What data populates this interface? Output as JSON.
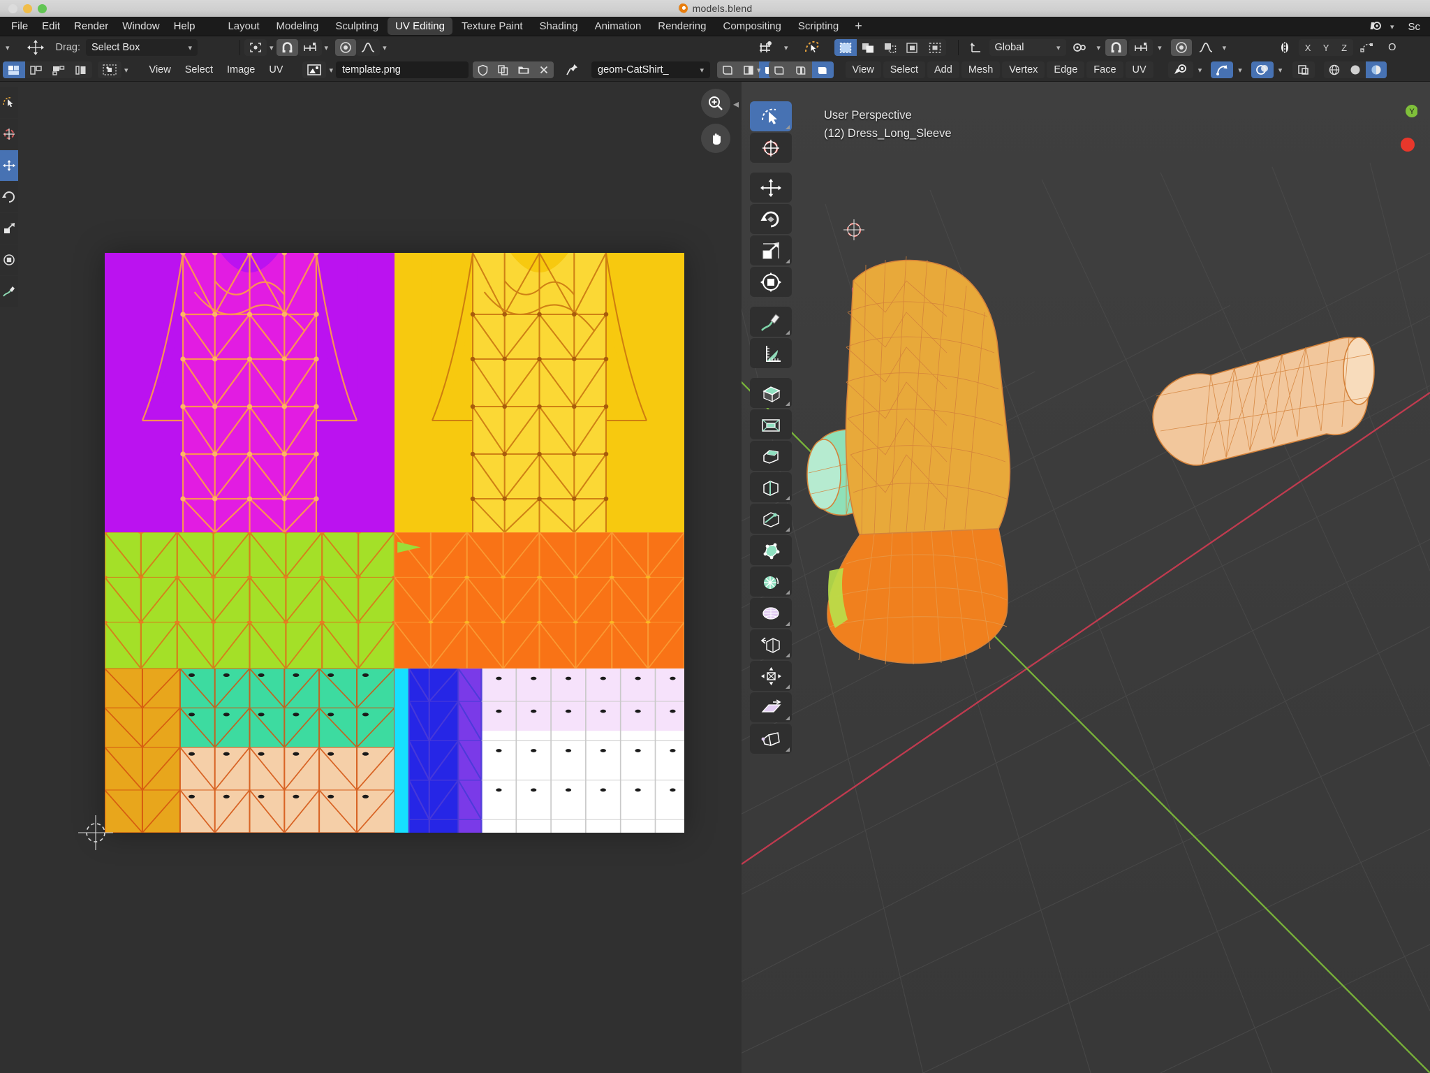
{
  "window": {
    "title": "models.blend",
    "logo_icon": "blender-logo"
  },
  "topbar": {
    "menus": [
      "File",
      "Edit",
      "Render",
      "Window",
      "Help"
    ],
    "workspaces": [
      {
        "label": "Layout",
        "active": false
      },
      {
        "label": "Modeling",
        "active": false
      },
      {
        "label": "Sculpting",
        "active": false
      },
      {
        "label": "UV Editing",
        "active": true
      },
      {
        "label": "Texture Paint",
        "active": false
      },
      {
        "label": "Shading",
        "active": false
      },
      {
        "label": "Animation",
        "active": false
      },
      {
        "label": "Rendering",
        "active": false
      },
      {
        "label": "Compositing",
        "active": false
      },
      {
        "label": "Scripting",
        "active": false
      }
    ],
    "add_workspace_label": "+",
    "scene_icon": "scene-icon",
    "scene_chevron": "chevron-down-icon",
    "scene_label": "Sc"
  },
  "uv_editor": {
    "tool_settings": {
      "editor_type_chevron": "chevron-down-icon",
      "transform_icon": "move-transform-icon",
      "drag_label": "Drag:",
      "drag_value": "Select Box",
      "drag_chevron": "chevron-down-icon",
      "pivot_icon": "pivot-point-icon",
      "pivot_chevron": "chevron-down-icon",
      "snap_magnet_icon": "snap-magnet-icon",
      "snap_type_icon": "snap-increment-icon",
      "snap_chevron": "chevron-down-icon",
      "proportional_icon": "proportional-edit-icon",
      "falloff_icon": "falloff-curve-icon",
      "falloff_chevron": "chevron-down-icon"
    },
    "header": {
      "uv_select_modes": [
        "uv-vertex-select-icon",
        "uv-edge-select-icon",
        "uv-face-select-icon",
        "uv-island-select-icon"
      ],
      "active_select_mode": 0,
      "sticky_icon": "sticky-selection-icon",
      "sticky_chevron": "chevron-down-icon",
      "menus": [
        "View",
        "Select",
        "Image",
        "UV"
      ],
      "image_icon": "image-datablock-icon",
      "image_chevron": "chevron-down-icon",
      "image_name": "template.png",
      "fake_user_icon": "shield-fake-user-icon",
      "new_copy_icon": "duplicate-icon",
      "open_icon": "folder-open-icon",
      "unlink_icon": "close-x-icon",
      "pin_icon": "pin-icon",
      "uvmap_name": "geom-CatShirt_",
      "uvmap_chevron": "chevron-down-icon",
      "display_modes": [
        "display-channels-icon",
        "display-overlay-a-icon",
        "display-overlay-b-icon"
      ],
      "active_display_mode": 2
    },
    "toolbar_icons": [
      "tweak-select-tool-icon",
      "cursor-tool-icon",
      "move-tool-icon",
      "rotate-tool-icon",
      "scale-tool-icon",
      "transform-tool-icon",
      "annotate-tool-icon"
    ],
    "active_toolbar_index": 2,
    "gizmos": [
      "zoom-gizmo-icon",
      "pan-hand-gizmo-icon"
    ],
    "collapse_icon": "chevron-left-icon",
    "uv_map_quadrants": [
      {
        "name": "shirt-front-magenta",
        "fill": "#e21ce2",
        "accent": "#bb12f0",
        "wire": "#ff8d3a"
      },
      {
        "name": "shirt-front-yellow",
        "fill": "#fbd42a",
        "accent": "#f5c400",
        "wire": "#c36a12"
      },
      {
        "name": "skirt-green",
        "fill": "#a4e028",
        "accent": "#a4e028",
        "wire": "#e06a18"
      },
      {
        "name": "skirt-orange",
        "fill": "#f97316",
        "accent": "#f97316",
        "wire": "#fbbf24"
      },
      {
        "name": "sleeves-teal-gold",
        "fill": "#3ddba0",
        "accent": "#e8a61c",
        "wire": "#d4520f"
      },
      {
        "name": "collar-blue-white",
        "fill": "#ffffff",
        "accent": "#2626e6",
        "wire": "#aaaaaa"
      }
    ]
  },
  "view3d": {
    "header": {
      "editor_icon": "editor-type-3dview-icon",
      "editor_chevron": "chevron-down-icon",
      "mode_icon": "edit-mode-icon",
      "select_modes": [
        "vertex-select-icon",
        "edge-select-icon",
        "face-select-icon"
      ],
      "mesh_select_icons": [
        "mesh-select-mode-a-icon",
        "mesh-select-mode-b-icon",
        "mesh-select-mode-c-icon",
        "mesh-select-mode-d-icon",
        "mesh-select-mode-e-icon"
      ],
      "active_mesh_select": 0,
      "orientation_icon": "transform-orientation-icon",
      "orientation_value": "Global",
      "orientation_chevron": "chevron-down-icon",
      "pivot_icon": "pivot-point-icon",
      "pivot_chevron": "chevron-down-icon",
      "snap_magnet_icon": "snap-magnet-icon",
      "snap_type_icon": "snap-increment-icon",
      "snap_chevron": "chevron-down-icon",
      "proportional_icon": "proportional-edit-icon",
      "falloff_icon": "falloff-curve-icon",
      "falloff_chevron": "chevron-down-icon",
      "mirror_icon": "x-mirror-icon",
      "mirror_axes": [
        "X",
        "Y",
        "Z"
      ],
      "mirror_topology_icon": "topology-mirror-icon",
      "options_label": "O",
      "menus": [
        "View",
        "Select",
        "Add",
        "Mesh",
        "Vertex",
        "Edge",
        "Face",
        "UV"
      ],
      "visibility_icon": "visibility-eye-icon",
      "visibility_chevron": "chevron-down-icon",
      "gizmo_icon": "gizmo-arrow-icon",
      "gizmo_chevron": "chevron-down-icon",
      "overlay_icon": "overlays-icon",
      "overlay_chevron": "chevron-down-icon",
      "xray_icon": "toggle-xray-icon",
      "shading_modes": [
        "shading-wireframe-icon",
        "shading-solid-icon",
        "shading-material-icon"
      ]
    },
    "overlay_text": {
      "line1": "User Perspective",
      "line2": "(12) Dress_Long_Sleeve"
    },
    "toolbar_icons": [
      "tweak-select-tool-icon",
      "cursor-tool-icon",
      "move-tool-icon",
      "rotate-tool-icon",
      "scale-tool-icon",
      "transform-tool-icon",
      "annotate-tool-icon",
      "measure-tool-icon",
      "extrude-region-tool-icon",
      "inset-faces-tool-icon",
      "bevel-tool-icon",
      "loop-cut-tool-icon",
      "knife-tool-icon",
      "poly-build-tool-icon",
      "spin-tool-icon",
      "smooth-tool-icon",
      "edge-slide-tool-icon",
      "shrink-fatten-tool-icon",
      "shear-tool-icon",
      "rip-region-tool-icon"
    ],
    "active_toolbar_index": 0,
    "axis_gizmo": {
      "y_label": "Y",
      "x_label": "",
      "z_label": ""
    },
    "record_indicator": "record-dot-icon",
    "cursor_3d_icon": "3d-cursor-icon",
    "model": {
      "name": "Dress_Long_Sleeve",
      "body_color": "#e8a93a",
      "skirt_color": "#f0801e",
      "sleeve_left_color": "#8fe0b8",
      "sleeve_right_color": "#f0c89a",
      "accent_magenta": "#e02ab0",
      "accent_purple": "#a06ad8",
      "wire_color": "#d4823a"
    },
    "grid": {
      "x_axis_color": "#cf3b52",
      "y_axis_color": "#7fc03a",
      "line_color": "#4a4a4a"
    }
  }
}
